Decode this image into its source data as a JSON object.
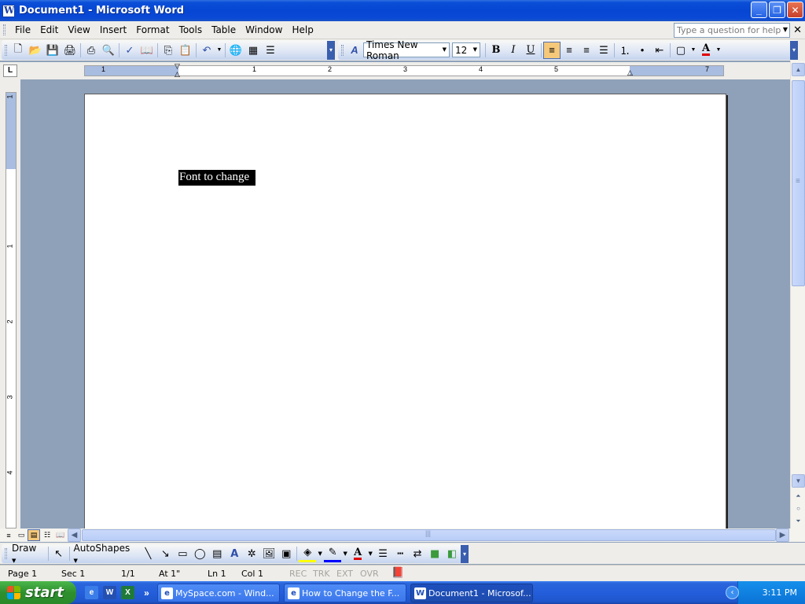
{
  "window": {
    "title": "Document1 - Microsoft Word",
    "minimize_label": "_",
    "maximize_label": "❐",
    "close_label": "✕"
  },
  "menu": {
    "items": [
      "File",
      "Edit",
      "View",
      "Insert",
      "Format",
      "Tools",
      "Table",
      "Window",
      "Help"
    ],
    "help_placeholder": "Type a question for help",
    "doc_close_label": "✕"
  },
  "formatting": {
    "font_name": "Times New Roman",
    "font_size": "12",
    "bold": "B",
    "italic": "I",
    "underline": "U",
    "font_color_letter": "A"
  },
  "ruler": {
    "numbers": [
      "1",
      "1",
      "2",
      "3",
      "4",
      "5",
      "7"
    ],
    "tab_selector": "L",
    "vertical_numbers": [
      "1",
      "1",
      "2",
      "3",
      "4"
    ]
  },
  "document": {
    "selected_text": "Font to change"
  },
  "drawing": {
    "draw_label": "Draw",
    "autoshapes_label": "AutoShapes"
  },
  "status": {
    "page": "Page 1",
    "sec": "Sec 1",
    "pages": "1/1",
    "at": "At 1\"",
    "ln": "Ln 1",
    "col": "Col 1",
    "rec": "REC",
    "trk": "TRK",
    "ext": "EXT",
    "ovr": "OVR"
  },
  "taskbar": {
    "start_label": "start",
    "tasks": [
      "MySpace.com - Wind...",
      "How to Change the F...",
      "Document1 - Microsof..."
    ],
    "clock": "3:11 PM",
    "overflow_label": "»"
  },
  "colors": {
    "accent": "#0a4ed8",
    "selection_bg": "#000000",
    "font_color_bar": "#e00000",
    "active_button": "#f5c87a"
  }
}
